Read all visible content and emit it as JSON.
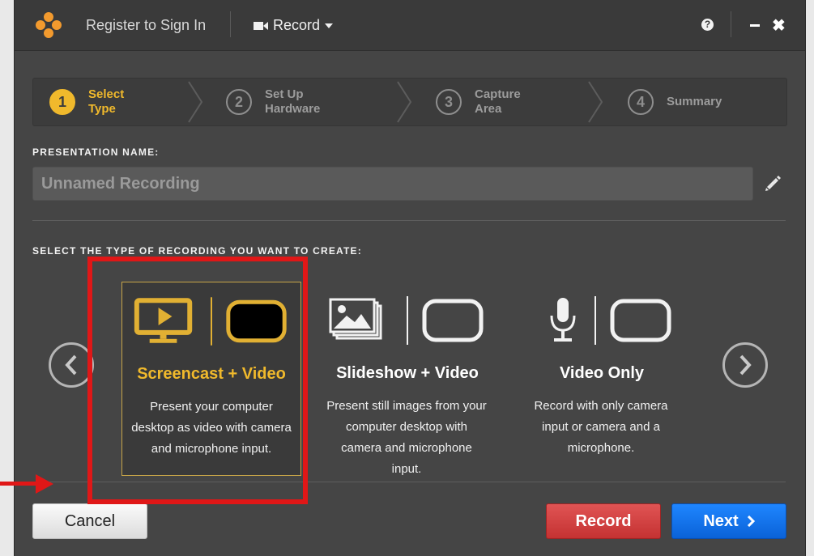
{
  "titlebar": {
    "register_label": "Register to Sign In",
    "record_menu_label": "Record",
    "help_label": "?",
    "minimize_label": "—",
    "close_label": "✖"
  },
  "steps": [
    {
      "number": "1",
      "line1": "Select",
      "line2": "Type",
      "active": true
    },
    {
      "number": "2",
      "line1": "Set Up",
      "line2": "Hardware",
      "active": false
    },
    {
      "number": "3",
      "line1": "Capture",
      "line2": "Area",
      "active": false
    },
    {
      "number": "4",
      "line1": "Summary",
      "line2": "",
      "active": false
    }
  ],
  "presentation": {
    "label": "PRESENTATION NAME:",
    "placeholder": "Unnamed Recording",
    "value": ""
  },
  "recording_types": {
    "label": "SELECT THE TYPE OF RECORDING YOU WANT TO CREATE:",
    "cards": [
      {
        "title": "Screencast + Video",
        "description": "Present your computer desktop as video with camera and microphone input.",
        "selected": true
      },
      {
        "title": "Slideshow + Video",
        "description": "Present still images from your computer desktop with camera and microphone input.",
        "selected": false
      },
      {
        "title": "Video Only",
        "description": "Record with only camera input or camera and a microphone.",
        "selected": false
      }
    ]
  },
  "buttons": {
    "cancel": "Cancel",
    "record": "Record",
    "next": "Next"
  },
  "colors": {
    "accent": "#f0b92c",
    "highlight": "#e01717",
    "record": "#d04242",
    "next": "#0a6fe8"
  }
}
